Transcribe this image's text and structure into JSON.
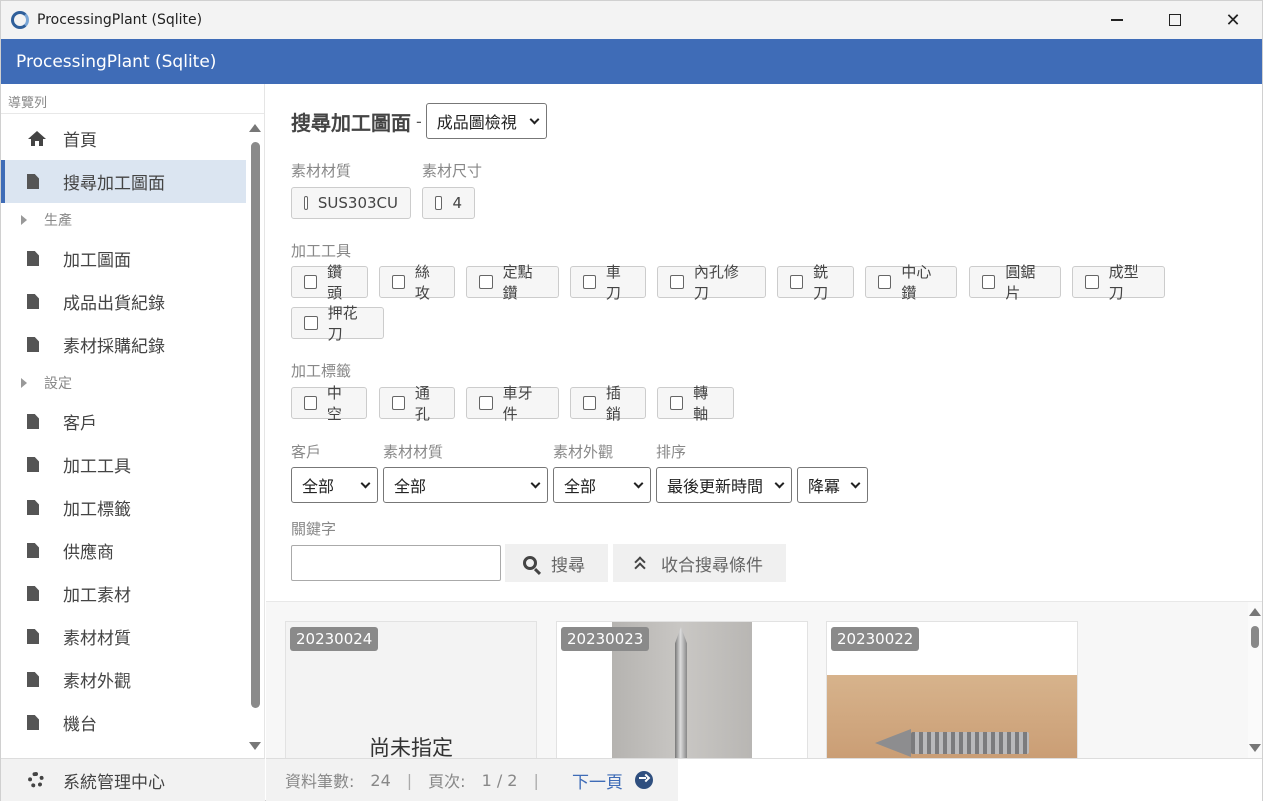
{
  "window": {
    "title": "ProcessingPlant (Sqlite)"
  },
  "header": {
    "title": "ProcessingPlant (Sqlite)"
  },
  "sidebar": {
    "caption": "導覽列",
    "items": [
      {
        "label": "首頁",
        "icon": "home-icon"
      },
      {
        "label": "搜尋加工圖面",
        "icon": "document-icon",
        "active": true
      },
      {
        "label": "生產",
        "group": true
      },
      {
        "label": "加工圖面",
        "icon": "document-icon"
      },
      {
        "label": "成品出貨紀錄",
        "icon": "document-icon"
      },
      {
        "label": "素材採購紀錄",
        "icon": "document-icon"
      },
      {
        "label": "設定",
        "group": true
      },
      {
        "label": "客戶",
        "icon": "document-icon"
      },
      {
        "label": "加工工具",
        "icon": "document-icon"
      },
      {
        "label": "加工標籤",
        "icon": "document-icon"
      },
      {
        "label": "供應商",
        "icon": "document-icon"
      },
      {
        "label": "加工素材",
        "icon": "document-icon"
      },
      {
        "label": "素材材質",
        "icon": "document-icon"
      },
      {
        "label": "素材外觀",
        "icon": "document-icon"
      },
      {
        "label": "機台",
        "icon": "document-icon"
      }
    ],
    "system_label": "系統管理中心"
  },
  "main": {
    "title": "搜尋加工圖面",
    "title_separator": "-",
    "view_select": "成品圖檢視",
    "material_label": "素材材質",
    "size_label": "素材尺寸",
    "material_options": [
      "SUS303CU"
    ],
    "size_options": [
      "4"
    ],
    "tools_label": "加工工具",
    "tools": [
      "鑽頭",
      "絲攻",
      "定點鑽",
      "車刀",
      "內孔修刀",
      "銑刀",
      "中心鑽",
      "圓鋸片",
      "成型刀",
      "押花刀"
    ],
    "tags_label": "加工標籤",
    "tags": [
      "中空",
      "通孔",
      "車牙件",
      "插銷",
      "轉軸"
    ],
    "filters": {
      "customer_label": "客戶",
      "customer_value": "全部",
      "material_label": "素材材質",
      "material_value": "全部",
      "appearance_label": "素材外觀",
      "appearance_value": "全部",
      "sort_label": "排序",
      "sort_value": "最後更新時間",
      "order_value": "降冪"
    },
    "keyword_label": "關鍵字",
    "keyword_value": "",
    "search_button": "搜尋",
    "collapse_button": "收合搜尋條件",
    "cards": [
      {
        "id": "20230024",
        "placeholder": "尚未指定"
      },
      {
        "id": "20230023"
      },
      {
        "id": "20230022"
      }
    ]
  },
  "pager": {
    "count_label": "資料筆數:",
    "count_value": "24",
    "separator": "|",
    "page_label": "頁次:",
    "page_value": "1 / 2",
    "next_label": "下一頁"
  },
  "colors": {
    "accent": "#3f6cb7",
    "active_bg": "#dbe5f1"
  }
}
